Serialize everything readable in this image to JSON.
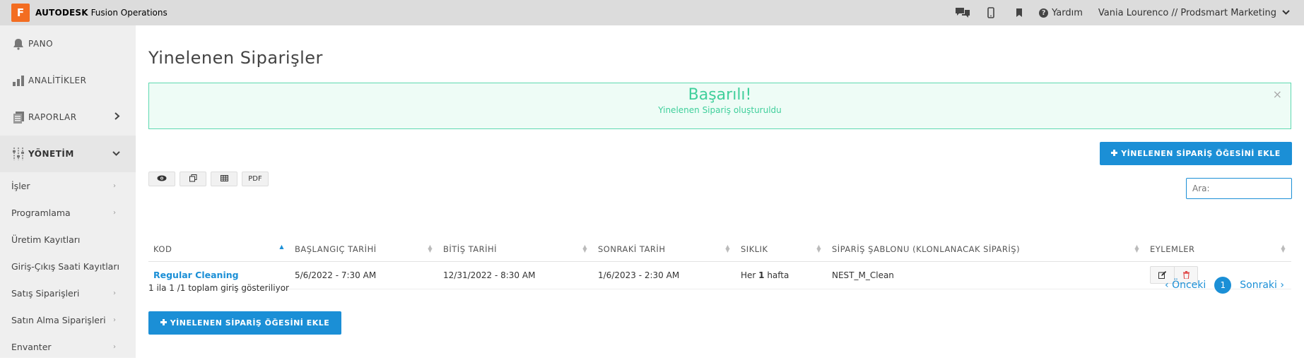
{
  "topbar": {
    "logo_letter": "F",
    "brand_bold": "AUTODESK",
    "brand_rest": " Fusion Operations",
    "help_label": "Yardım",
    "user_name": "Vania Lourenco // Prodsmart Marketing",
    "icons": [
      "chat-icon",
      "mobile-icon",
      "bookmark-icon",
      "help-icon"
    ]
  },
  "sidebar": {
    "items": [
      {
        "label": "PANO",
        "icon": "bell-icon"
      },
      {
        "label": "ANALİTİKLER",
        "icon": "bar-chart-icon"
      },
      {
        "label": "RAPORLAR",
        "icon": "report-icon"
      },
      {
        "label": "YÖNETİM",
        "icon": "sliders-icon"
      }
    ],
    "sub_items": [
      {
        "label": "İşler"
      },
      {
        "label": "Programlama"
      },
      {
        "label": "Üretim Kayıtları"
      },
      {
        "label": "Giriş-Çıkış Saati Kayıtları"
      },
      {
        "label": "Satış Siparişleri"
      },
      {
        "label": "Satın Alma Siparişleri"
      },
      {
        "label": "Envanter"
      }
    ]
  },
  "main": {
    "title": "Yinelenen Siparişler",
    "alert": {
      "title": "Başarılı!",
      "message": "Yinelenen Sipariş oluşturuldu",
      "close": "×"
    },
    "add_button": "YİNELENEN SİPARİŞ ÖĞESİNİ EKLE",
    "tools": [
      "eye-icon",
      "copy-icon",
      "table-icon",
      "PDF"
    ],
    "pdf_label": "PDF",
    "search_placeholder": "Ara:",
    "table": {
      "columns": [
        "KOD",
        "BAŞLANGIÇ TARİHİ",
        "BİTİŞ TARİHİ",
        "SONRAKİ TARİH",
        "SIKLIK",
        "SİPARİŞ ŞABLONU (KLONLANACAK SİPARİŞ)",
        "EYLEMLER"
      ],
      "rows": [
        {
          "code": "Regular Cleaning",
          "start": "5/6/2022 - 7:30 AM",
          "end": "12/31/2022 - 8:30 AM",
          "next": "1/6/2023 - 2:30 AM",
          "freq_prefix": "Her ",
          "freq_num": "1",
          "freq_suffix": " hafta",
          "template": "NEST_M_Clean"
        }
      ]
    },
    "info": "1 ila 1 /1 toplam giriş gösteriliyor",
    "pager": {
      "prev": "Önceki",
      "page": "1",
      "next": "Sonraki"
    }
  }
}
